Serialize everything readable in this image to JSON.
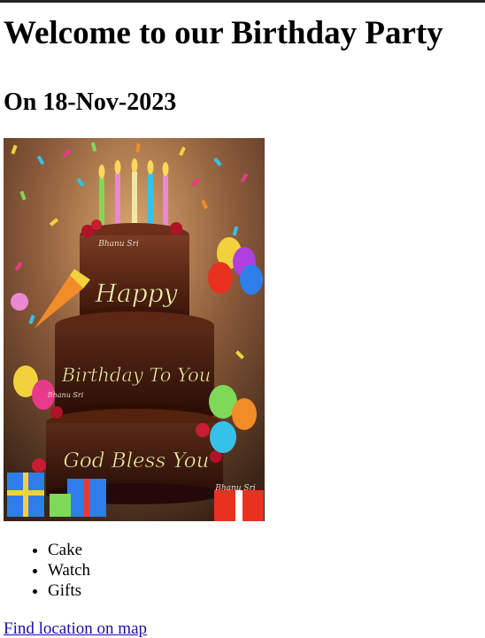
{
  "page": {
    "title": "Welcome to our Birthday Party",
    "subtitle": "On 18-Nov-2023"
  },
  "image": {
    "wish_line1": "Happy",
    "wish_line2": "Birthday To You",
    "wish_line3": "God Bless You",
    "watermark": "Bhanu Sri"
  },
  "gifts": {
    "items": [
      "Cake",
      "Watch",
      "Gifts"
    ]
  },
  "links": {
    "map": "Find location on map"
  }
}
